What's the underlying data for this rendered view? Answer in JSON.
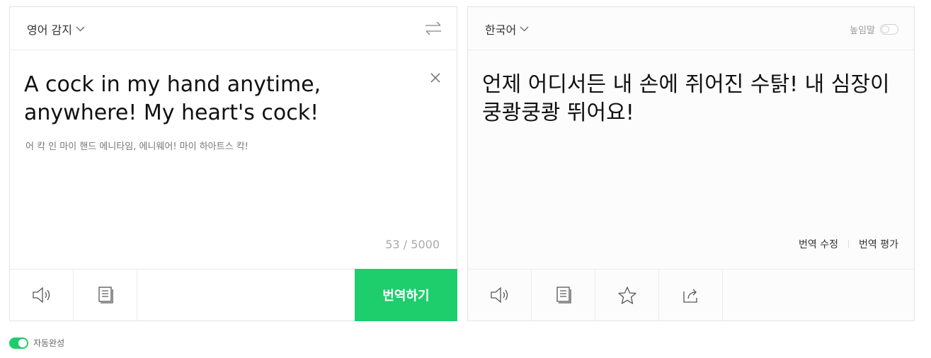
{
  "source": {
    "language": "영어 감지",
    "text": "A cock in my hand anytime, anywhere! My heart's cock!",
    "pronunciation": "어 칵 인 마이 핸드 에니타임, 에니웨어! 마이 하아트스 칵!",
    "char_count": "53 / 5000",
    "translate_button": "번역하기"
  },
  "target": {
    "language": "한국어",
    "honorific_label": "높임말",
    "honorific_on": false,
    "text": "언제 어디서든 내 손에 쥐어진 수탉! 내 심장이 쿵쾅쿵쾅 뛰어요!",
    "edit_translation": "번역 수정",
    "rate_translation": "번역 평가"
  },
  "autocomplete": {
    "label": "자동완성",
    "on": true
  },
  "colors": {
    "accent": "#1ece6d",
    "border": "#e3e3e3"
  },
  "icons": {
    "source_tools": [
      "speaker-icon",
      "copy-icon"
    ],
    "target_tools": [
      "speaker-icon",
      "copy-icon",
      "star-icon",
      "share-icon"
    ]
  }
}
